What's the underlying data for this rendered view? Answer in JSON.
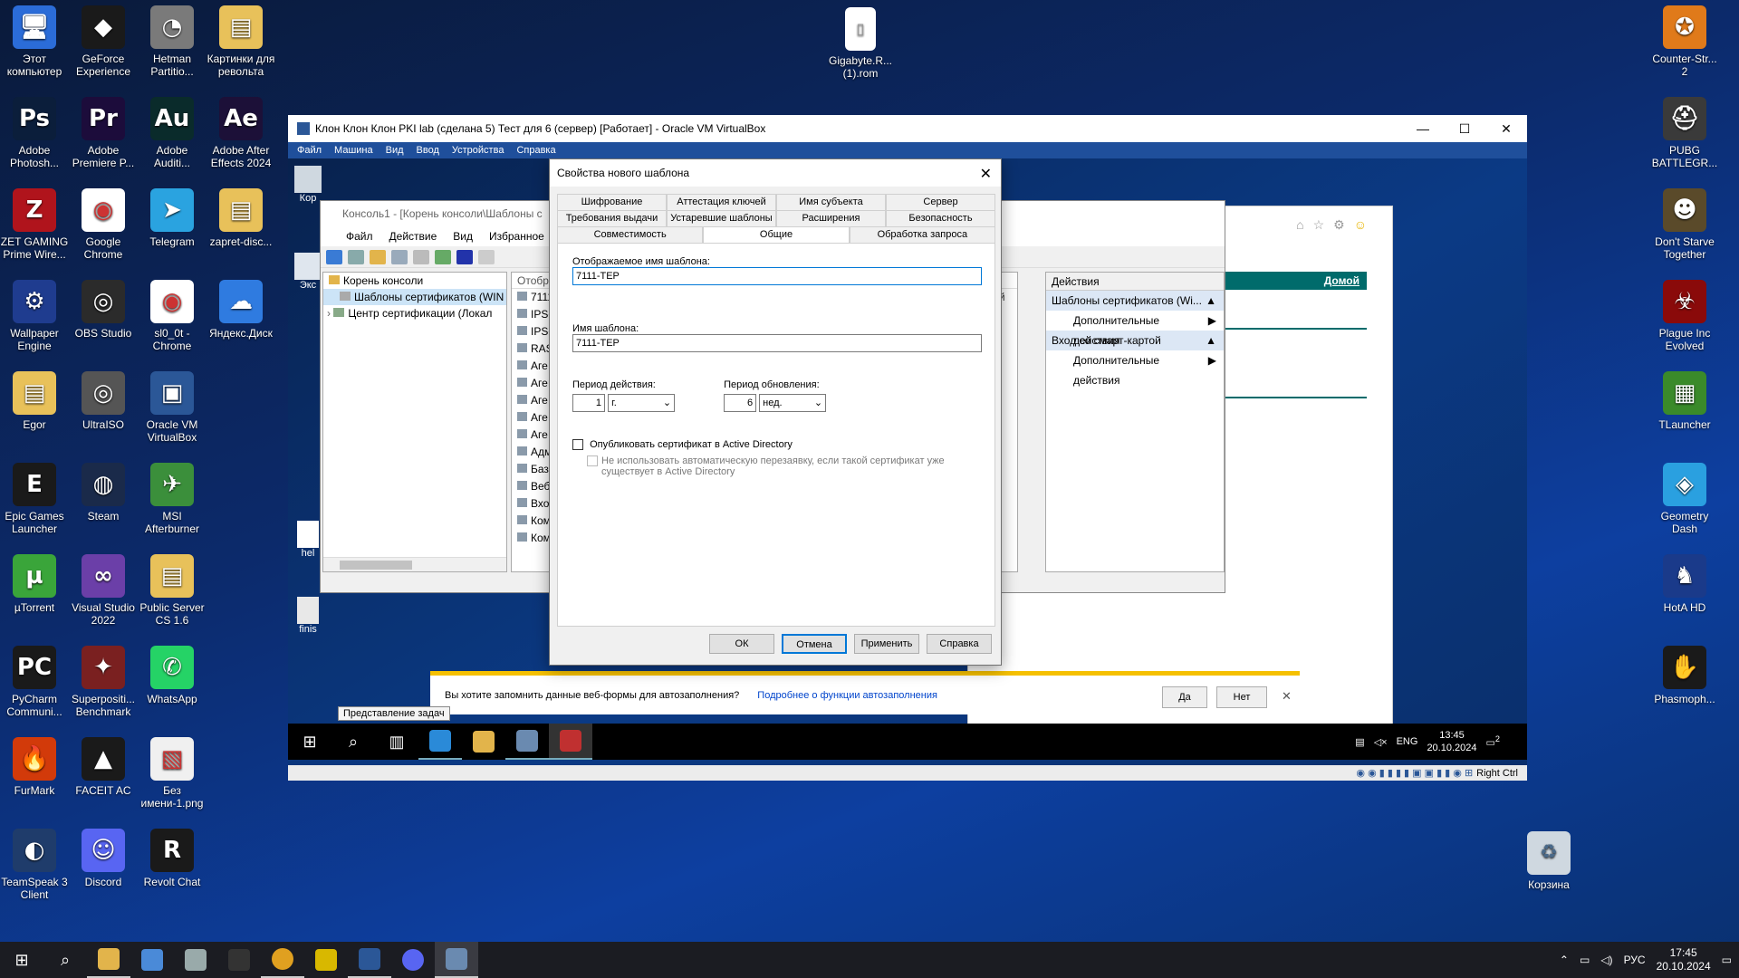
{
  "host_desktop": {
    "left_icons": [
      {
        "label": "Этот компьютер",
        "color": "#2b6cd8",
        "glyph": "🖥"
      },
      {
        "label": "GeForce Experience",
        "color": "#1a1a1a",
        "glyph": "◆"
      },
      {
        "label": "Hetman Partitio...",
        "color": "#7a7a7a",
        "glyph": "◔"
      },
      {
        "label": "Картинки для револьта",
        "color": "#e8c15a",
        "glyph": "▤"
      },
      {
        "label": "Adobe Photosh...",
        "color": "#0b1e3b",
        "glyph": "Ps"
      },
      {
        "label": "Adobe Premiere P...",
        "color": "#1c0c3b",
        "glyph": "Pr"
      },
      {
        "label": "Adobe Auditi...",
        "color": "#0a2b2b",
        "glyph": "Au"
      },
      {
        "label": "Adobe After Effects 2024",
        "color": "#1c1038",
        "glyph": "Ae"
      },
      {
        "label": "ZET GAMING Prime Wire...",
        "color": "#b0141c",
        "glyph": "Z"
      },
      {
        "label": "Google Chrome",
        "color": "#ffffff",
        "glyph": "◉"
      },
      {
        "label": "Telegram",
        "color": "#2aa3e0",
        "glyph": "➤"
      },
      {
        "label": "zapret-disc...",
        "color": "#e8c15a",
        "glyph": "▤"
      },
      {
        "label": "Wallpaper Engine",
        "color": "#1f3c8f",
        "glyph": "⚙"
      },
      {
        "label": "OBS Studio",
        "color": "#2b2b2b",
        "glyph": "◎"
      },
      {
        "label": "sl0_0t - Chrome",
        "color": "#ffffff",
        "glyph": "◉"
      },
      {
        "label": "Яндекс.Диск",
        "color": "#2f7be0",
        "glyph": "☁"
      },
      {
        "label": "Egor",
        "color": "#e8c15a",
        "glyph": "▤"
      },
      {
        "label": "UltraISO",
        "color": "#555555",
        "glyph": "◎"
      },
      {
        "label": "Oracle VM VirtualBox",
        "color": "#2b5797",
        "glyph": "▣"
      },
      {
        "label": "",
        "color": "transparent",
        "glyph": ""
      },
      {
        "label": "Epic Games Launcher",
        "color": "#1a1a1a",
        "glyph": "E"
      },
      {
        "label": "Steam",
        "color": "#1a2a4a",
        "glyph": "◍"
      },
      {
        "label": "MSI Afterburner",
        "color": "#3b8f3b",
        "glyph": "✈"
      },
      {
        "label": "",
        "color": "transparent",
        "glyph": ""
      },
      {
        "label": "µTorrent",
        "color": "#3aa53a",
        "glyph": "µ"
      },
      {
        "label": "Visual Studio 2022",
        "color": "#6b3fa8",
        "glyph": "∞"
      },
      {
        "label": "Public Server CS 1.6",
        "color": "#e8c15a",
        "glyph": "▤"
      },
      {
        "label": "",
        "color": "transparent",
        "glyph": ""
      },
      {
        "label": "PyCharm Communi...",
        "color": "#1a1a1a",
        "glyph": "PC"
      },
      {
        "label": "Superpositi... Benchmark",
        "color": "#7a2020",
        "glyph": "✦"
      },
      {
        "label": "WhatsApp",
        "color": "#25d366",
        "glyph": "✆"
      },
      {
        "label": "",
        "color": "transparent",
        "glyph": ""
      },
      {
        "label": "FurMark",
        "color": "#d23a0a",
        "glyph": "🔥"
      },
      {
        "label": "FACEIT AC",
        "color": "#1a1a1a",
        "glyph": "▲"
      },
      {
        "label": "Без имени-1.png",
        "color": "#f0f0f0",
        "glyph": "▧"
      },
      {
        "label": "",
        "color": "transparent",
        "glyph": ""
      },
      {
        "label": "TeamSpeak 3 Client",
        "color": "#1f3c6b",
        "glyph": "◐"
      },
      {
        "label": "Discord",
        "color": "#5865f2",
        "glyph": "☺"
      },
      {
        "label": "Revolt Chat",
        "color": "#1a1a1a",
        "glyph": "R"
      }
    ],
    "right_icons": [
      {
        "label": "Counter-Str... 2",
        "color": "#e07a1a",
        "glyph": "✪"
      },
      {
        "label": "PUBG BATTLEGR...",
        "color": "#3a3a3a",
        "glyph": "⛑"
      },
      {
        "label": "Don't Starve Together",
        "color": "#5a4a2a",
        "glyph": "☻"
      },
      {
        "label": "Plague Inc Evolved",
        "color": "#8a0a0a",
        "glyph": "☣"
      },
      {
        "label": "TLauncher",
        "color": "#3a8a2a",
        "glyph": "▦"
      },
      {
        "label": "Geometry Dash",
        "color": "#2aa0e0",
        "glyph": "◈"
      },
      {
        "label": "HotA HD",
        "color": "#1a3a8a",
        "glyph": "♞"
      },
      {
        "label": "Phasmoph...",
        "color": "#1a1a1a",
        "glyph": "✋"
      }
    ],
    "file_icon": "Gigabyte.R... (1).rom",
    "recycle_bin": "Корзина",
    "taskbar": {
      "lang": "РУС",
      "time": "17:45",
      "date": "20.10.2024"
    }
  },
  "vbox": {
    "title": "Клон Клон Клон PKI lab (сделана 5) Тест для 6 (сервер) [Работает] - Oracle VM VirtualBox",
    "menu": [
      "Файл",
      "Машина",
      "Вид",
      "Ввод",
      "Устройства",
      "Справка"
    ],
    "status_right": "Right Ctrl"
  },
  "guest": {
    "icons": [
      "Кор",
      "Экс",
      "hel",
      "finis"
    ],
    "taskbar": {
      "lang": "ENG",
      "time": "13:45",
      "date": "20.10.2024",
      "notif": "2"
    },
    "tooltip": "Представление задач"
  },
  "mmc": {
    "title": "Консоль1 - [Корень консоли\\Шаблоны с",
    "menu": [
      "Файл",
      "Действие",
      "Вид",
      "Избранное"
    ],
    "tree": [
      "Корень консоли",
      "Шаблоны сертификатов (WIN",
      "Центр сертификации (Локал"
    ],
    "list_header": "Отобр",
    "list_items": [
      "7111",
      "IPSe",
      "IPSe",
      "RAS",
      "Аге",
      "Аге",
      "Аге",
      "Аге",
      "Аге",
      "Адм",
      "Базо",
      "Веб",
      "Вхо",
      "Ком",
      "Ком"
    ],
    "right_fragments": [
      "нной",
      "мно",
      "лен"
    ],
    "actions": {
      "header": "Действия",
      "sections": [
        {
          "title": "Шаблоны сертификатов (Wi...",
          "item": "Дополнительные действия"
        },
        {
          "title": "Вход со смарт-картой",
          "item": "Дополнительные действия"
        }
      ]
    },
    "browser_link": "Домой"
  },
  "dialog": {
    "title": "Свойства нового шаблона",
    "tabs_row1": [
      "Шифрование",
      "Аттестация ключей",
      "Имя субъекта",
      "Сервер"
    ],
    "tabs_row2": [
      "Требования выдачи",
      "Устаревшие шаблоны",
      "Расширения",
      "Безопасность"
    ],
    "tabs_row3": [
      "Совместимость",
      "Общие",
      "Обработка запроса"
    ],
    "display_name_label": "Отображаемое имя шаблона:",
    "display_name_value": "7111-TEP",
    "template_name_label": "Имя шаблона:",
    "template_name_value": "7111-TEP",
    "validity_label": "Период действия:",
    "validity_value": "1",
    "validity_unit": "г.",
    "renewal_label": "Период обновления:",
    "renewal_value": "6",
    "renewal_unit": "нед.",
    "publish_label": "Опубликовать сертификат в Active Directory",
    "no_reenroll_label": "Не использовать автоматическую перезаявку, если такой сертификат уже существует в Active Directory",
    "buttons": {
      "ok": "ОК",
      "cancel": "Отмена",
      "apply": "Применить",
      "help": "Справка"
    }
  },
  "autofill": {
    "question": "Вы хотите запомнить данные веб-формы для автозаполнения?",
    "link": "Подробнее о функции автозаполнения",
    "yes": "Да",
    "no": "Нет"
  }
}
